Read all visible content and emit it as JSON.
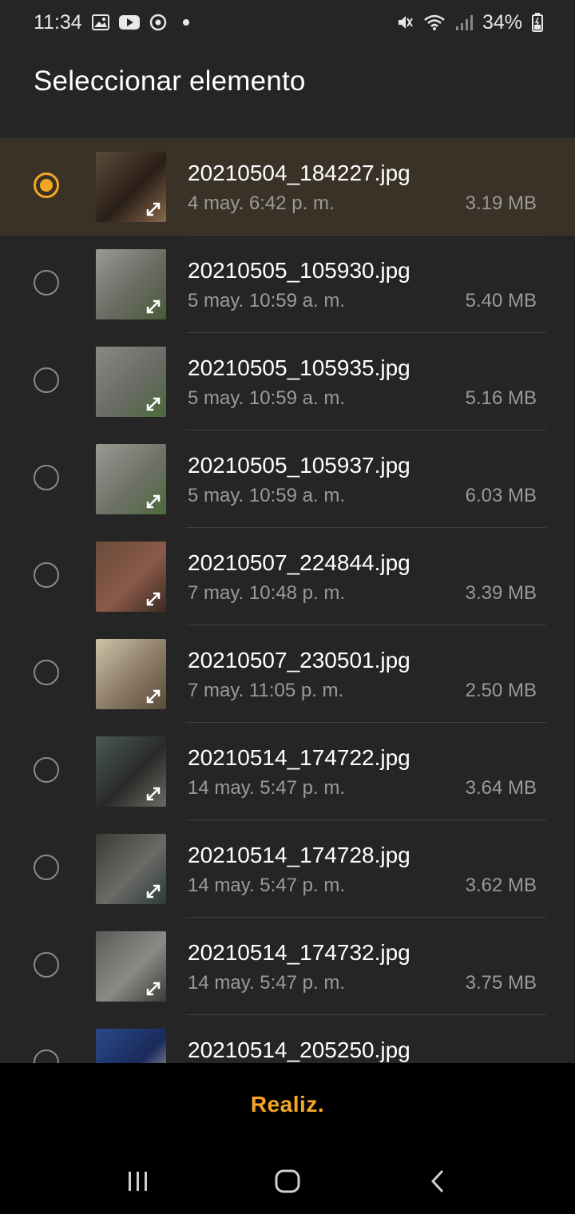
{
  "status_bar": {
    "time": "11:34",
    "battery": "34%",
    "icons_left": [
      "gallery-icon",
      "youtube-icon",
      "sync-icon",
      "notification-dot"
    ],
    "icons_right": [
      "mute-icon",
      "wifi-icon",
      "signal-icon",
      "battery-icon"
    ]
  },
  "header": {
    "title": "Seleccionar elemento"
  },
  "accent_color": "#f5a623",
  "items": [
    {
      "name": "20210504_184227.jpg",
      "date": "4 may. 6:42 p. m.",
      "size": "3.19 MB",
      "selected": true
    },
    {
      "name": "20210505_105930.jpg",
      "date": "5 may. 10:59 a. m.",
      "size": "5.40 MB",
      "selected": false
    },
    {
      "name": "20210505_105935.jpg",
      "date": "5 may. 10:59 a. m.",
      "size": "5.16 MB",
      "selected": false
    },
    {
      "name": "20210505_105937.jpg",
      "date": "5 may. 10:59 a. m.",
      "size": "6.03 MB",
      "selected": false
    },
    {
      "name": "20210507_224844.jpg",
      "date": "7 may. 10:48 p. m.",
      "size": "3.39 MB",
      "selected": false
    },
    {
      "name": "20210507_230501.jpg",
      "date": "7 may. 11:05 p. m.",
      "size": "2.50 MB",
      "selected": false
    },
    {
      "name": "20210514_174722.jpg",
      "date": "14 may. 5:47 p. m.",
      "size": "3.64 MB",
      "selected": false
    },
    {
      "name": "20210514_174728.jpg",
      "date": "14 may. 5:47 p. m.",
      "size": "3.62 MB",
      "selected": false
    },
    {
      "name": "20210514_174732.jpg",
      "date": "14 may. 5:47 p. m.",
      "size": "3.75 MB",
      "selected": false
    },
    {
      "name": "20210514_205250.jpg",
      "date": "",
      "size": "",
      "selected": false
    }
  ],
  "action_bar": {
    "done_label": "Realiz."
  },
  "nav_bar": {
    "buttons": [
      "recents-icon",
      "home-icon",
      "back-icon"
    ]
  }
}
